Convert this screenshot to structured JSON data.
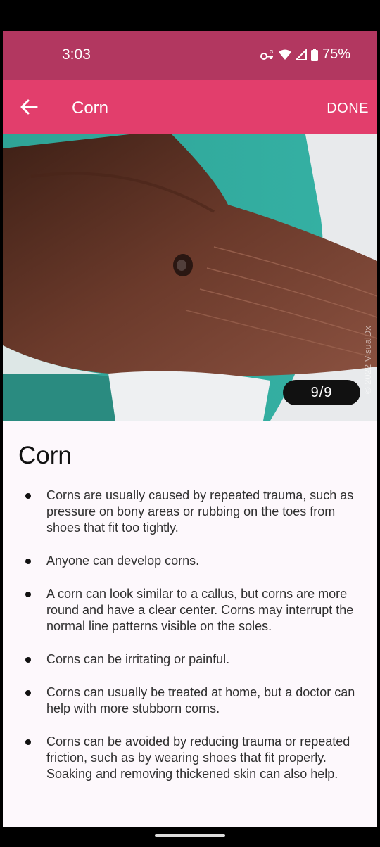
{
  "status": {
    "time": "3:03",
    "battery": "75%"
  },
  "app_bar": {
    "title": "Corn",
    "done_label": "DONE"
  },
  "gallery": {
    "counter": "9/9",
    "watermark": "© 2022 VisualDx"
  },
  "content": {
    "heading": "Corn",
    "bullets": [
      "Corns are usually caused by repeated trauma, such as pressure on bony areas or rubbing on the toes from shoes that fit too tightly.",
      "Anyone can develop corns.",
      "A corn can look similar to a callus, but corns are more round and have a clear center. Corns may interrupt the normal line patterns visible on the soles.",
      "Corns can be irritating or painful.",
      "Corns can usually be treated at home, but a doctor can help with more stubborn corns.",
      "Corns can be avoided by reducing trauma or repeated friction, such as by wearing shoes that fit properly. Soaking and removing thickened skin can also help."
    ]
  },
  "colors": {
    "status_bar": "#b23760",
    "app_bar": "#e23e6c",
    "content_bg": "#fdf8fc"
  }
}
